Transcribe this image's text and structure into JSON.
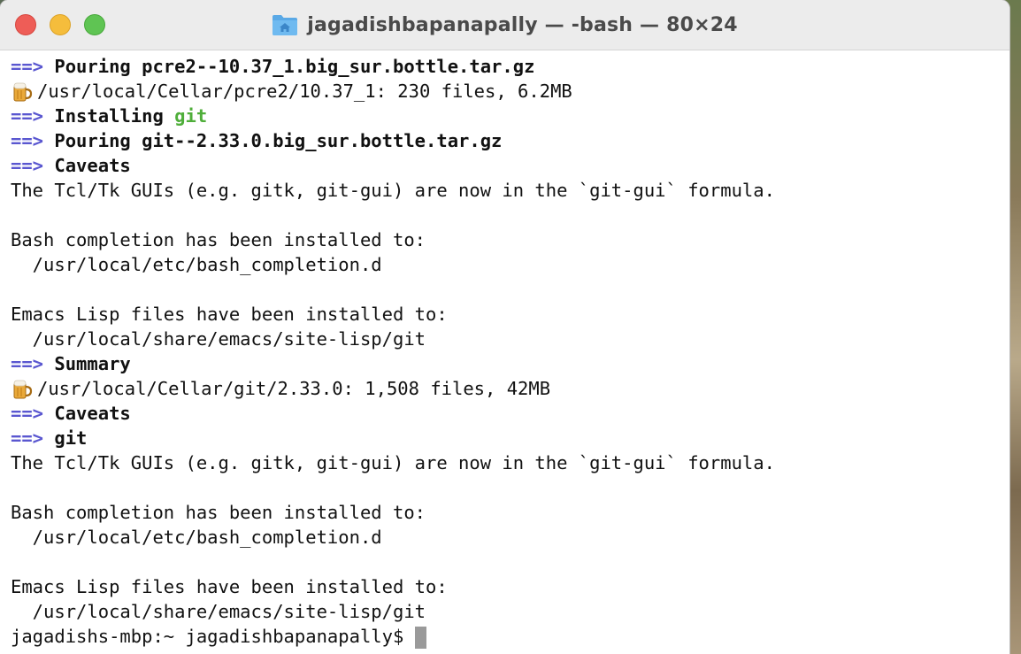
{
  "window": {
    "title": "jagadishbapanapally — -bash — 80×24",
    "folder_icon": "folder-home-icon"
  },
  "colors": {
    "arrow": "#5a57d0",
    "highlight": "#4fae3a",
    "cursor": "#9a9a9a"
  },
  "terminal": {
    "arrow": "==>",
    "beer_icon": "beer-mug-icon",
    "lines": {
      "l1": "Pouring pcre2--10.37_1.big_sur.bottle.tar.gz",
      "l2": "/usr/local/Cellar/pcre2/10.37_1: 230 files, 6.2MB",
      "l3a": "Installing ",
      "l3b": "git",
      "l4": "Pouring git--2.33.0.big_sur.bottle.tar.gz",
      "l5": "Caveats",
      "l6": "The Tcl/Tk GUIs (e.g. gitk, git-gui) are now in the `git-gui` formula.",
      "l8": "Bash completion has been installed to:",
      "l9": "  /usr/local/etc/bash_completion.d",
      "l11": "Emacs Lisp files have been installed to:",
      "l12": "  /usr/local/share/emacs/site-lisp/git",
      "l13": "Summary",
      "l14": "/usr/local/Cellar/git/2.33.0: 1,508 files, 42MB",
      "l15": "Caveats",
      "l16": "git",
      "l17": "The Tcl/Tk GUIs (e.g. gitk, git-gui) are now in the `git-gui` formula.",
      "l19": "Bash completion has been installed to:",
      "l20": "  /usr/local/etc/bash_completion.d",
      "l22": "Emacs Lisp files have been installed to:",
      "l23": "  /usr/local/share/emacs/site-lisp/git"
    },
    "prompt": "jagadishs-mbp:~ jagadishbapanapally$"
  }
}
